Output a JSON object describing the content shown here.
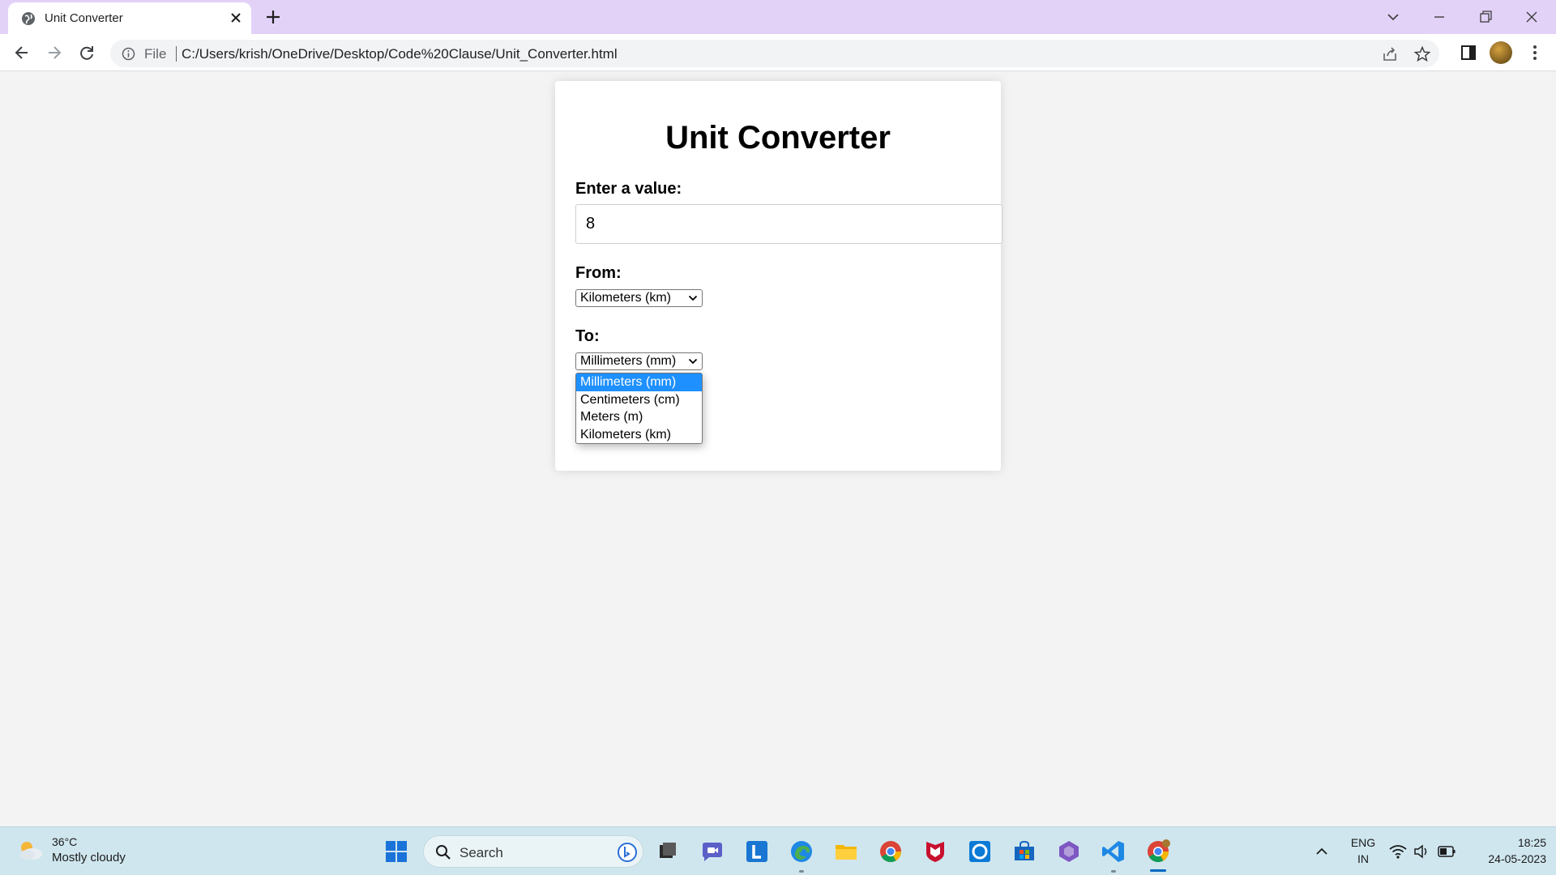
{
  "browser": {
    "tab_title": "Unit Converter",
    "address_prefix": "File",
    "url": "C:/Users/krish/OneDrive/Desktop/Code%20Clause/Unit_Converter.html"
  },
  "page": {
    "title": "Unit Converter",
    "value_label": "Enter a value:",
    "value": "8",
    "from_label": "From:",
    "from_selected": "Kilometers (km)",
    "to_label": "To:",
    "to_selected": "Millimeters (mm)",
    "to_options": [
      "Millimeters (mm)",
      "Centimeters (cm)",
      "Meters (m)",
      "Kilometers (km)"
    ]
  },
  "taskbar": {
    "weather_temp": "36°C",
    "weather_desc": "Mostly cloudy",
    "search_placeholder": "Search",
    "lang_line1": "ENG",
    "lang_line2": "IN",
    "time": "18:25",
    "date": "24-05-2023"
  },
  "colors": {
    "tab_strip": "#e3d2f8",
    "selected_option": "#1e90ff",
    "taskbar": "#cfe6ee"
  }
}
